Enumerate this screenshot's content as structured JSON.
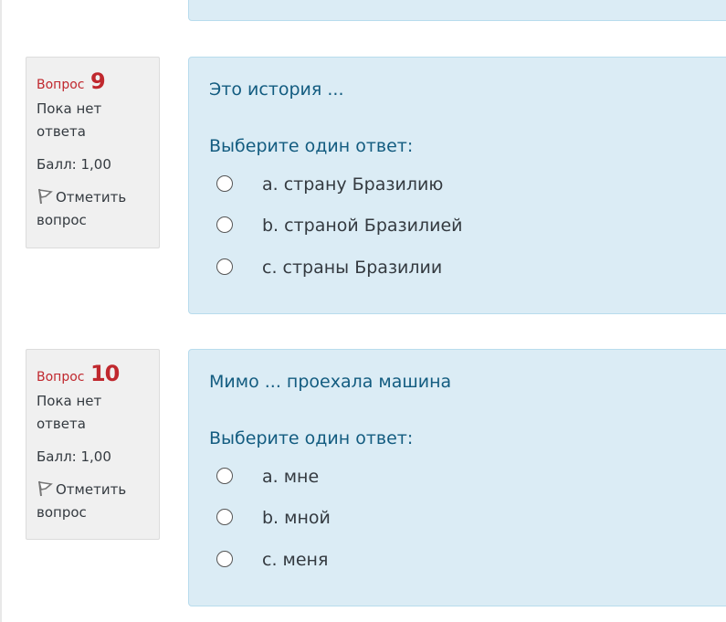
{
  "questions": [
    {
      "label": "Вопрос",
      "number": "9",
      "state": "Пока нет ответа",
      "grade": "Балл: 1,00",
      "flag": "Отметить вопрос",
      "text": "Это история ...",
      "prompt": "Выберите один ответ:",
      "answers": [
        "a. страну Бразилию",
        "b. страной Бразилией",
        "c. страны Бразилии"
      ]
    },
    {
      "label": "Вопрос",
      "number": "10",
      "state": "Пока нет ответа",
      "grade": "Балл: 1,00",
      "flag": "Отметить вопрос",
      "text": "Мимо ... проехала машина",
      "prompt": "Выберите один ответ:",
      "answers": [
        "a. мне",
        "b. мной",
        "c. меня"
      ]
    }
  ],
  "icons": {
    "flag": "flag-icon"
  },
  "colors": {
    "content_bg": "#dbecf5",
    "question_number": "#c0282e",
    "question_text": "#135c80"
  }
}
